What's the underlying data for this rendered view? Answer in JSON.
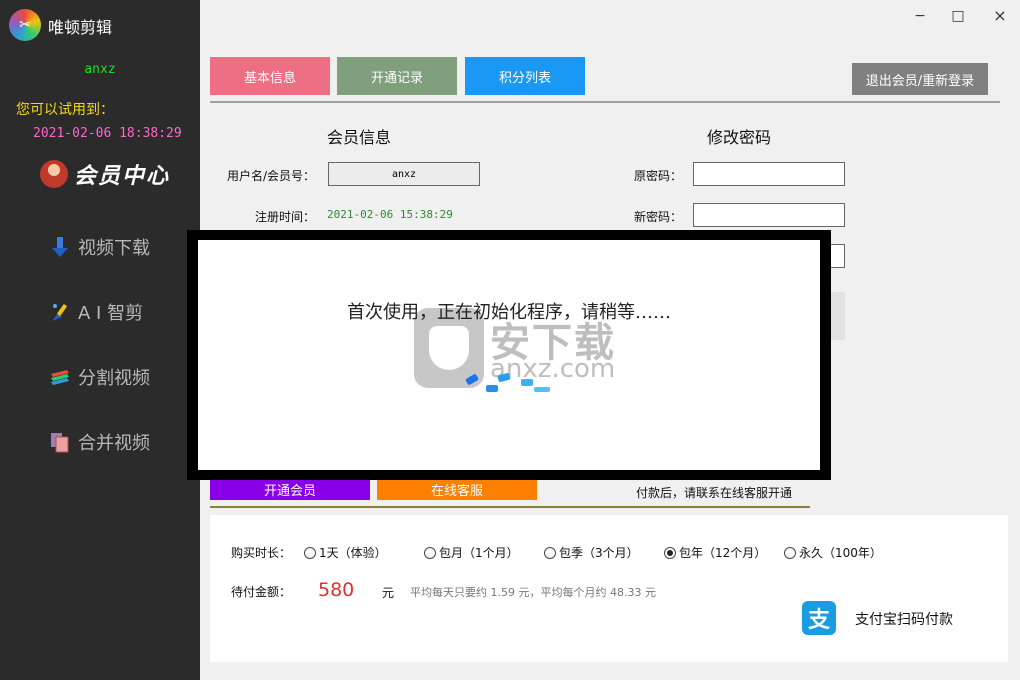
{
  "sidebar": {
    "app_title": "唯顿剪辑",
    "username": "anxz",
    "trial_label": "您可以试用到：",
    "trial_time": "2021-02-06 18:38:29",
    "member_center": "会员中心",
    "nav": [
      {
        "label": "视频下载",
        "icon": "download-arrow-icon"
      },
      {
        "label": "A I 智剪",
        "icon": "ai-brush-icon"
      },
      {
        "label": "分割视频",
        "icon": "split-layers-icon"
      },
      {
        "label": "合并视频",
        "icon": "merge-files-icon"
      }
    ]
  },
  "window": {
    "minimize": "−",
    "maximize": "□",
    "close": "×"
  },
  "tabs": [
    {
      "label": "基本信息",
      "color": "#ee6e84"
    },
    {
      "label": "开通记录",
      "color": "#7f9f7d"
    },
    {
      "label": "积分列表",
      "color": "#1a98f5"
    }
  ],
  "logout_label": "退出会员/重新登录",
  "member_info": {
    "title": "会员信息",
    "username_label": "用户名/会员号：",
    "username_value": "anxz",
    "reg_label": "注册时间：",
    "reg_value": "2021-02-06 15:38:29"
  },
  "change_password": {
    "title": "修改密码",
    "old_label": "原密码：",
    "new_label": "新密码："
  },
  "overlay": {
    "message": "首次使用，正在初始化程序，请稍等……",
    "watermark_cn": "安下载",
    "watermark_en": "anxz.com"
  },
  "actions": {
    "open_member": {
      "label": "开通会员",
      "color": "#8a00e6"
    },
    "online_service": {
      "label": "在线客服",
      "color": "#ff7f00"
    },
    "pay_note": "付款后，请联系在线客服开通"
  },
  "payment": {
    "duration_label": "购买时长：",
    "options": [
      {
        "label": "1天（体验）",
        "checked": false
      },
      {
        "label": "包月（1个月）",
        "checked": false
      },
      {
        "label": "包季（3个月）",
        "checked": false
      },
      {
        "label": "包年（12个月）",
        "checked": true
      },
      {
        "label": "永久（100年）",
        "checked": false
      }
    ],
    "amount_label": "待付金额：",
    "amount_value": "580",
    "amount_unit": "元",
    "amount_note": "平均每天只要约 1.59 元，平均每个月约 48.33 元",
    "alipay_icon_glyph": "支",
    "alipay_label": "支付宝扫码付款"
  }
}
